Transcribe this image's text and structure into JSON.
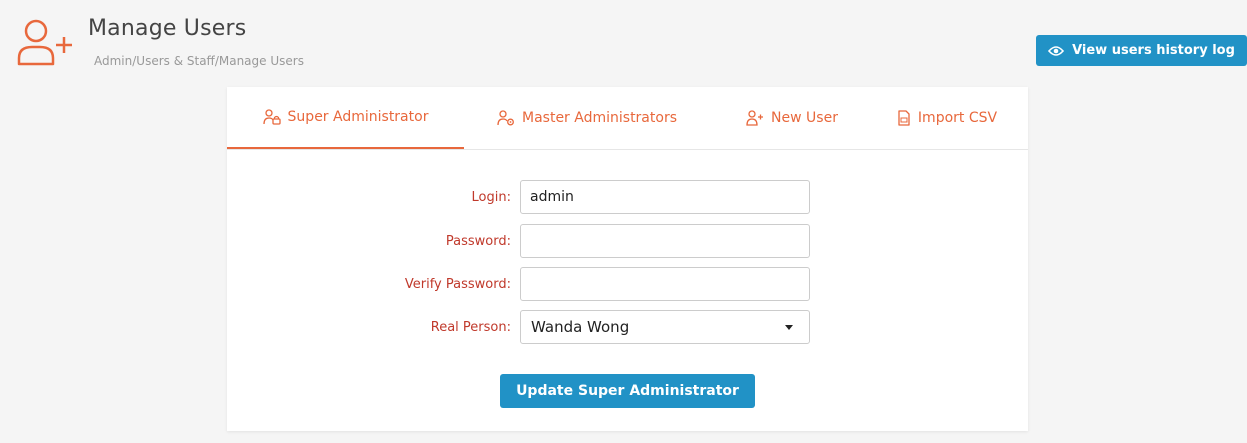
{
  "header": {
    "title": "Manage Users",
    "breadcrumb": "Admin/Users & Staff/Manage Users",
    "icon": "add-user-icon"
  },
  "actions": {
    "history_button": "View users history log",
    "history_icon": "eye-icon"
  },
  "tabs": [
    {
      "label": "Super Administrator",
      "icon": "user-lock-icon",
      "active": true
    },
    {
      "label": "Master Administrators",
      "icon": "user-gear-icon",
      "active": false
    },
    {
      "label": "New User",
      "icon": "user-plus-icon",
      "active": false
    },
    {
      "label": "Import CSV",
      "icon": "csv-file-icon",
      "active": false
    }
  ],
  "form": {
    "login": {
      "label": "Login:",
      "value": "admin"
    },
    "password": {
      "label": "Password:",
      "value": ""
    },
    "verify_password": {
      "label": "Verify Password:",
      "value": ""
    },
    "real_person": {
      "label": "Real Person:",
      "value": "Wanda Wong"
    },
    "submit_label": "Update Super Administrator"
  },
  "colors": {
    "accent": "#e8683c",
    "primary_button": "#2192c6",
    "label": "#c0392b",
    "background": "#f5f5f5"
  }
}
